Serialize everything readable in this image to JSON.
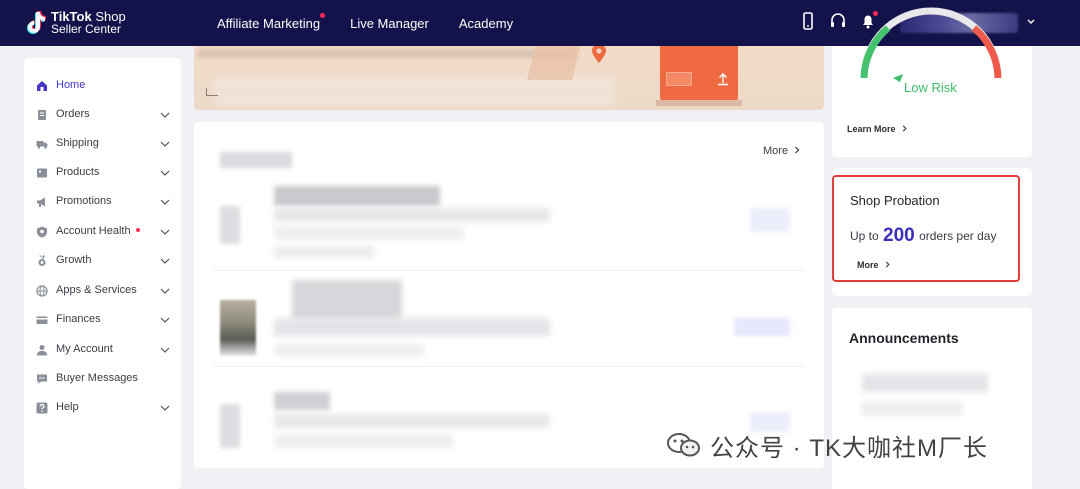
{
  "brand": {
    "line1_bold": "TikTok",
    "line1_light": "Shop",
    "line2": "Seller Center"
  },
  "topnav": [
    {
      "label": "Affiliate Marketing",
      "has_dot": true
    },
    {
      "label": "Live Manager",
      "has_dot": false
    },
    {
      "label": "Academy",
      "has_dot": false
    }
  ],
  "top_icons": [
    "mobile-icon",
    "headset-icon",
    "bell-icon"
  ],
  "sidebar": {
    "items": [
      {
        "label": "Home",
        "icon": "home-icon",
        "active": true,
        "expandable": false,
        "dot": false
      },
      {
        "label": "Orders",
        "icon": "orders-icon",
        "active": false,
        "expandable": true,
        "dot": false
      },
      {
        "label": "Shipping",
        "icon": "truck-icon",
        "active": false,
        "expandable": true,
        "dot": false
      },
      {
        "label": "Products",
        "icon": "products-icon",
        "active": false,
        "expandable": true,
        "dot": false
      },
      {
        "label": "Promotions",
        "icon": "megaphone-icon",
        "active": false,
        "expandable": true,
        "dot": false
      },
      {
        "label": "Account Health",
        "icon": "shield-icon",
        "active": false,
        "expandable": true,
        "dot": true
      },
      {
        "label": "Growth",
        "icon": "medal-icon",
        "active": false,
        "expandable": true,
        "dot": false
      },
      {
        "label": "Apps & Services",
        "icon": "globe-icon",
        "active": false,
        "expandable": true,
        "dot": false
      },
      {
        "label": "Finances",
        "icon": "card-icon",
        "active": false,
        "expandable": true,
        "dot": false
      },
      {
        "label": "My Account",
        "icon": "user-icon",
        "active": false,
        "expandable": true,
        "dot": false
      },
      {
        "label": "Buyer Messages",
        "icon": "chat-icon",
        "active": false,
        "expandable": false,
        "dot": false
      },
      {
        "label": "Help",
        "icon": "help-icon",
        "active": false,
        "expandable": true,
        "dot": false
      }
    ]
  },
  "main": {
    "more_label": "More"
  },
  "risk": {
    "label": "Low Risk",
    "learn_more": "Learn More"
  },
  "probation": {
    "title": "Shop Probation",
    "prefix": "Up to",
    "value": "200",
    "suffix": "orders per day",
    "more": "More"
  },
  "announcements": {
    "title": "Announcements"
  },
  "watermark": {
    "text": "公众号 · TK大咖社M厂长"
  },
  "colors": {
    "topbar": "#14124a",
    "accent": "#4438ca",
    "probation_value": "#3a2fb8",
    "highlight_border": "#e0403a",
    "low_risk": "#3fbf6c",
    "notification_dot": "#fe2c55"
  }
}
